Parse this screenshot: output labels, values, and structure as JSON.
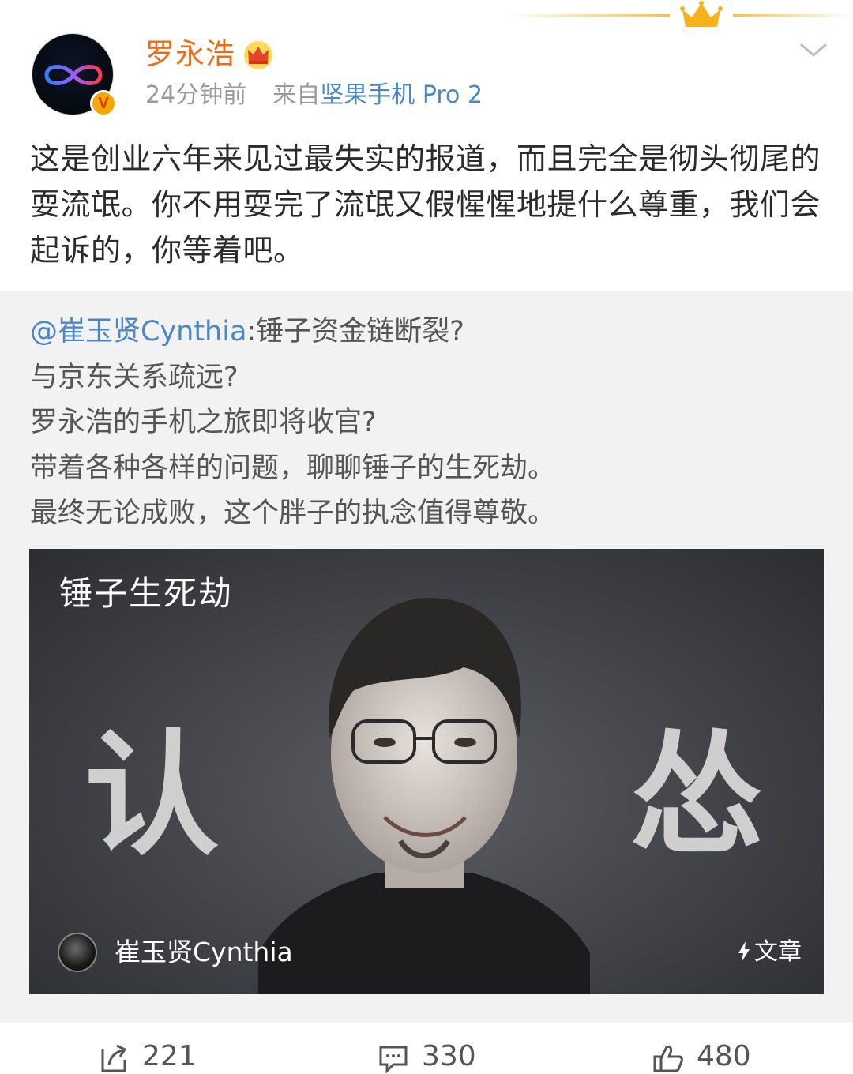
{
  "post": {
    "username": "罗永浩",
    "time": "24分钟前",
    "source_prefix": "来自",
    "source": "坚果手机 Pro 2",
    "verified_badge": "V",
    "text": "这是创业六年来见过最失实的报道，而且完全是彻头彻尾的耍流氓。你不用耍完了流氓又假惺惺地提什么尊重，我们会起诉的，你等着吧。"
  },
  "repost": {
    "mention": "@崔玉贤Cynthia",
    "lines": [
      ":锤子资金链断裂?",
      "与京东关系疏远?",
      "罗永浩的手机之旅即将收官?",
      "带着各种各样的问题，聊聊锤子的生死劫。",
      "最终无论成败，这个胖子的执念值得尊敬。"
    ],
    "card": {
      "title": "锤子生死劫",
      "big_left": "认",
      "big_right": "怂",
      "author": "崔玉贤Cynthia",
      "tag": "文章"
    }
  },
  "actions": {
    "reposts": "221",
    "comments": "330",
    "likes": "480"
  },
  "icons": {
    "crown": "crown-icon",
    "chevron": "chevron-down-icon",
    "repost": "repost-icon",
    "comment": "comment-icon",
    "like": "thumbs-up-icon",
    "bolt": "bolt-icon"
  },
  "colors": {
    "username": "#f26b12",
    "link": "#4a87c8",
    "repost_bg": "#f2f2f2"
  }
}
